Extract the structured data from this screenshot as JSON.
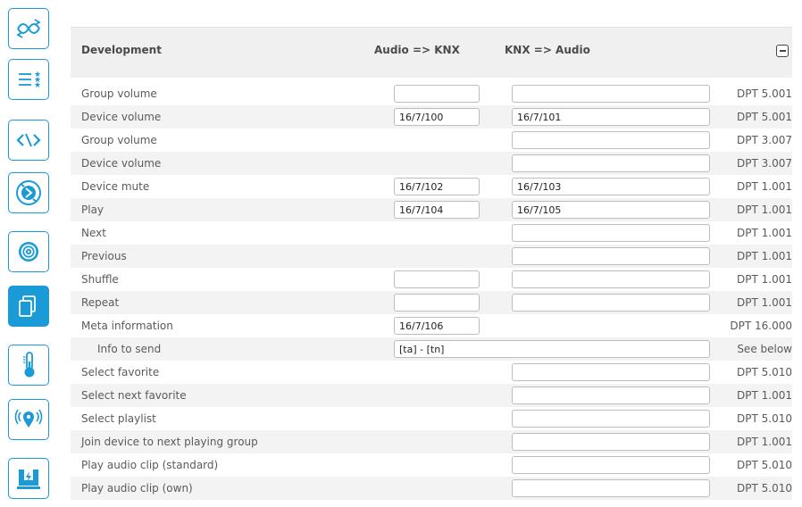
{
  "sidebar": {
    "items": [
      {
        "icon": "shuffle-icon",
        "active": false
      },
      {
        "icon": "favorites-list-icon",
        "active": false
      },
      {
        "icon": "code-icon",
        "active": false
      },
      {
        "icon": "sync-icon",
        "active": false
      },
      {
        "icon": "target-icon",
        "active": false
      },
      {
        "icon": "copy-icon",
        "active": true
      },
      {
        "icon": "thermometer-icon",
        "active": false
      },
      {
        "icon": "location-signal-icon",
        "active": false
      },
      {
        "icon": "power-plug-icon",
        "active": false
      }
    ],
    "accent": "#1a9ad6"
  },
  "header": {
    "title": "Development",
    "col_audio_knx": "Audio => KNX",
    "col_knx_audio": "KNX => Audio"
  },
  "rows": [
    {
      "label": "Group volume",
      "audio_knx": "",
      "knx_audio": "",
      "dpt": "DPT 5.001"
    },
    {
      "label": "Device volume",
      "audio_knx": "16/7/100",
      "knx_audio": "16/7/101",
      "dpt": "DPT 5.001"
    },
    {
      "label": "Group volume",
      "knx_audio": "",
      "dpt": "DPT 3.007"
    },
    {
      "label": "Device volume",
      "knx_audio": "",
      "dpt": "DPT 3.007"
    },
    {
      "label": "Device mute",
      "audio_knx": "16/7/102",
      "knx_audio": "16/7/103",
      "dpt": "DPT 1.001"
    },
    {
      "label": "Play",
      "audio_knx": "16/7/104",
      "knx_audio": "16/7/105",
      "dpt": "DPT 1.001"
    },
    {
      "label": "Next",
      "knx_audio": "",
      "dpt": "DPT 1.001"
    },
    {
      "label": "Previous",
      "knx_audio": "",
      "dpt": "DPT 1.001"
    },
    {
      "label": "Shuffle",
      "audio_knx": "",
      "knx_audio": "",
      "dpt": "DPT 1.001"
    },
    {
      "label": "Repeat",
      "audio_knx": "",
      "knx_audio": "",
      "dpt": "DPT 1.001"
    },
    {
      "label": "Meta information",
      "audio_knx": "16/7/106",
      "dpt": "DPT 16.000"
    },
    {
      "label": "Info to send",
      "indent": true,
      "wide": "[ta] - [tn]",
      "dpt": "See below"
    },
    {
      "label": "Select favorite",
      "knx_audio": "",
      "dpt": "DPT 5.010"
    },
    {
      "label": "Select next favorite",
      "knx_audio": "",
      "dpt": "DPT 1.001"
    },
    {
      "label": "Select playlist",
      "knx_audio": "",
      "dpt": "DPT 5.010"
    },
    {
      "label": "Join device to next playing group",
      "knx_audio": "",
      "dpt": "DPT 1.001"
    },
    {
      "label": "Play audio clip (standard)",
      "knx_audio": "",
      "dpt": "DPT 5.010"
    },
    {
      "label": "Play audio clip (own)",
      "knx_audio": "",
      "dpt": "DPT 5.010"
    }
  ]
}
